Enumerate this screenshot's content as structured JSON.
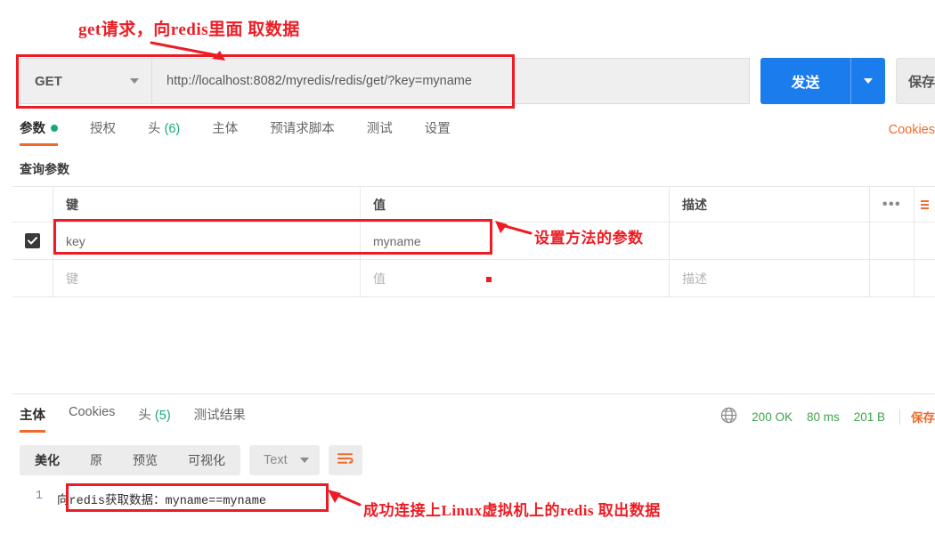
{
  "request": {
    "method": "GET",
    "url": "http://localhost:8082/myredis/redis/get/?key=myname",
    "send_label": "发送",
    "save_label": "保存",
    "cookies_link": "Cookies"
  },
  "request_tabs": [
    {
      "label": "参数",
      "badge": "",
      "dot": true
    },
    {
      "label": "授权",
      "badge": "",
      "dot": false
    },
    {
      "label": "头",
      "badge": "(6)",
      "dot": false
    },
    {
      "label": "主体",
      "badge": "",
      "dot": false
    },
    {
      "label": "预请求脚本",
      "badge": "",
      "dot": false
    },
    {
      "label": "测试",
      "badge": "",
      "dot": false
    },
    {
      "label": "设置",
      "badge": "",
      "dot": false
    }
  ],
  "params": {
    "section_title": "查询参数",
    "columns": [
      "键",
      "值",
      "描述"
    ],
    "menu_icon": "•••",
    "rows": [
      {
        "checked": true,
        "key": "key",
        "value": "myname",
        "desc": ""
      }
    ],
    "placeholder_row": {
      "key": "键",
      "value": "值",
      "desc": "描述"
    }
  },
  "response_tabs": [
    {
      "label": "主体",
      "badge": ""
    },
    {
      "label": "Cookies",
      "badge": ""
    },
    {
      "label": "头",
      "badge": "(5)"
    },
    {
      "label": "测试结果",
      "badge": ""
    }
  ],
  "response_status": {
    "code": "200 OK",
    "time": "80 ms",
    "size": "201 B",
    "save_label": "保存"
  },
  "response_toolbar": {
    "views": [
      "美化",
      "原",
      "预览",
      "可视化"
    ],
    "type": "Text"
  },
  "response_body": {
    "line_number": "1",
    "content": "向redis获取数据：myname==myname"
  },
  "annotations": {
    "top": "get请求，向redis里面 取数据",
    "params": "设置方法的参数",
    "bottom": "成功连接上Linux虚拟机上的redis 取出数据"
  },
  "colors": {
    "accent_orange": "#f06a2b",
    "send_blue": "#1b7ced",
    "status_green": "#3fa34d",
    "annotation_red": "#ed1c24"
  }
}
